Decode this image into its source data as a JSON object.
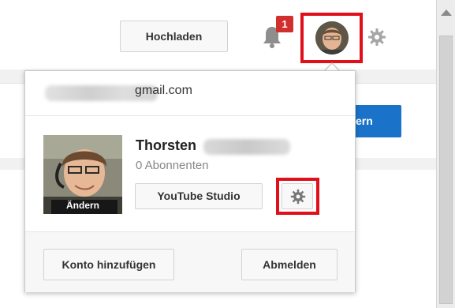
{
  "header": {
    "upload_label": "Hochladen",
    "notification_count": "1",
    "notification_icon": "bell-icon",
    "settings_icon": "gear-icon"
  },
  "page": {
    "blue_button_partial": "ern"
  },
  "account_menu": {
    "email_domain": "gmail.com",
    "user_first_name": "Thorsten",
    "subscribers": "0 Abonnenten",
    "change_photo_label": "Ändern",
    "studio_label": "YouTube Studio",
    "add_account_label": "Konto hinzufügen",
    "logout_label": "Abmelden"
  },
  "colors": {
    "highlight_red": "#e0101a",
    "badge_red": "#d12e2e",
    "brand_blue": "#1a73c8"
  }
}
